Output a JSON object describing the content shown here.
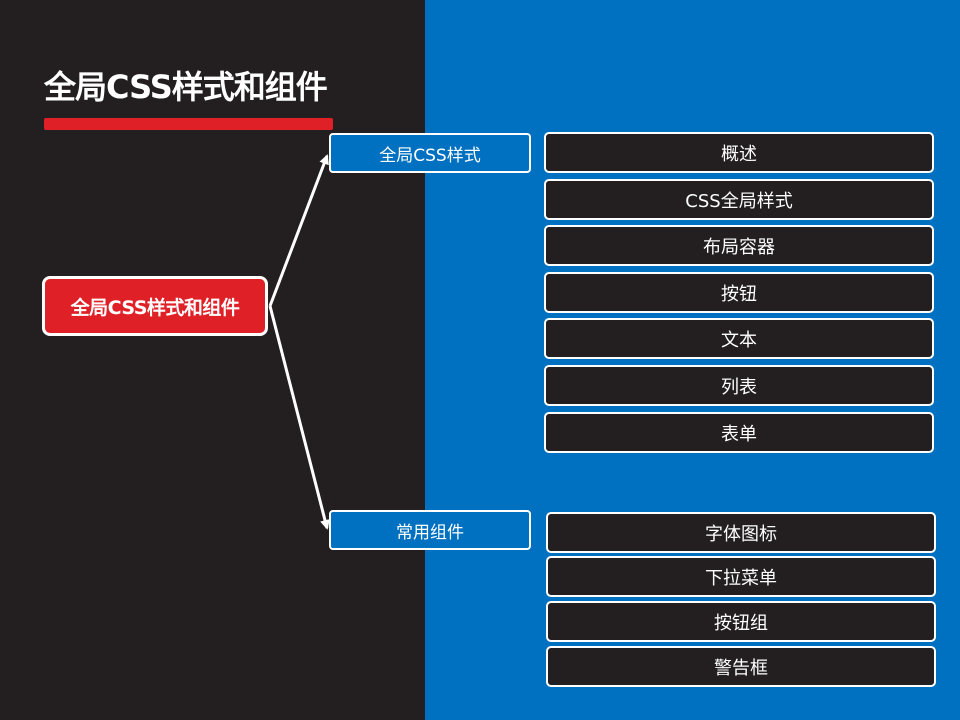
{
  "title": "全局CSS样式和组件",
  "colors": {
    "left_background": "#231f20",
    "right_background": "#0070c0",
    "accent_red": "#e02027",
    "node_dark": "#231f20",
    "node_blue": "#0070c0",
    "line": "#ffffff"
  },
  "root": {
    "label": "全局CSS样式和组件"
  },
  "branches": [
    {
      "label": "全局CSS样式",
      "children": [
        "概述",
        "CSS全局样式",
        "布局容器",
        "按钮",
        "文本",
        "列表",
        "表单"
      ]
    },
    {
      "label": "常用组件",
      "children": [
        "字体图标",
        "下拉菜单",
        "按钮组",
        "警告框"
      ]
    }
  ]
}
